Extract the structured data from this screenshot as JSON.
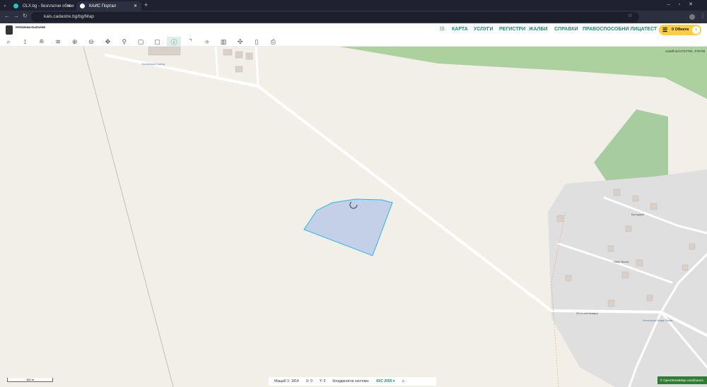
{
  "browser": {
    "tabs": [
      {
        "title": "OLX.bg - безплатни обяви"
      },
      {
        "title": "КАИС Портал"
      }
    ],
    "url": "kais.cadastre.bg/bg/Map"
  },
  "header": {
    "logo_text": "РЕПУБЛИКА БЪЛГАРИЯ",
    "menu": [
      "КАРТА",
      "УСЛУГИ",
      "РЕГИСТРИ",
      "ЖАЛБИ",
      "СПРАВКИ",
      "ПРАВОСПОСОБНИ ЛИЦА",
      "ТЕСТ"
    ],
    "cart_label": "0 Обекти"
  },
  "toolbar": {
    "tools": [
      {
        "icon": "search-icon"
      },
      {
        "icon": "route-icon"
      },
      {
        "icon": "layer-icon"
      },
      {
        "icon": "layers-icon"
      },
      {
        "icon": "zoom-in-icon"
      },
      {
        "icon": "zoom-out-icon"
      },
      {
        "icon": "pan-icon"
      },
      {
        "icon": "pin-icon"
      },
      {
        "icon": "select-rect-icon"
      },
      {
        "icon": "select-rect2-icon"
      },
      {
        "icon": "info-icon",
        "active": true
      },
      {
        "icon": "measure-line-icon"
      },
      {
        "icon": "measure-area-icon"
      },
      {
        "icon": "map-icon"
      },
      {
        "icon": "cross-icon"
      },
      {
        "icon": "note-icon"
      },
      {
        "icon": "print-icon"
      }
    ]
  },
  "map": {
    "coords": "undefined:4737782, 479738",
    "scale_bar": "100 m",
    "labels": {
      "road1": "23-ти септември",
      "street1": "Иван Вазов",
      "street2": "Бузлуджа",
      "poi1": "Кооперация Свобод",
      "poi2": "Кооперация Мадан Вазов"
    },
    "attribution": "© OpenStreetMap contributors."
  },
  "status": {
    "scale_label": "Мащаб 1:",
    "scale_value": "1814",
    "x_label": "X:",
    "x_value": "0",
    "y_label": "Y:",
    "y_value": "0",
    "crs_label": "Координатна система:",
    "crs_value": "ККС 2005"
  },
  "colors": {
    "accent": "#1f8a6a",
    "polygon": "#29b6e8",
    "cart": "#f9cd44"
  }
}
